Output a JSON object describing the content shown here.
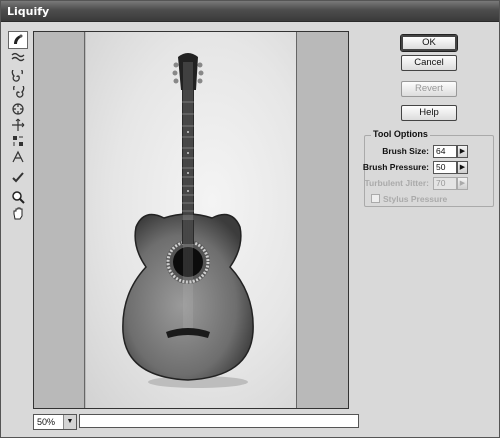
{
  "window": {
    "title": "Liquify"
  },
  "buttons": {
    "ok": "OK",
    "cancel": "Cancel",
    "revert": "Revert",
    "help": "Help"
  },
  "tool_options": {
    "legend": "Tool Options",
    "brush_size_label": "Brush Size:",
    "brush_size_value": "64",
    "brush_pressure_label": "Brush Pressure:",
    "brush_pressure_value": "50",
    "turbulent_jitter_label": "Turbulent Jitter:",
    "turbulent_jitter_value": "70",
    "stylus_pressure_label": "Stylus Pressure"
  },
  "zoom": {
    "value": "50%"
  },
  "tools": [
    "forward-warp",
    "reconstruct",
    "twirl-clockwise",
    "pucker",
    "bloat",
    "push-left",
    "mirror",
    "turbulence",
    "freeze-mask",
    "zoom",
    "hand"
  ]
}
